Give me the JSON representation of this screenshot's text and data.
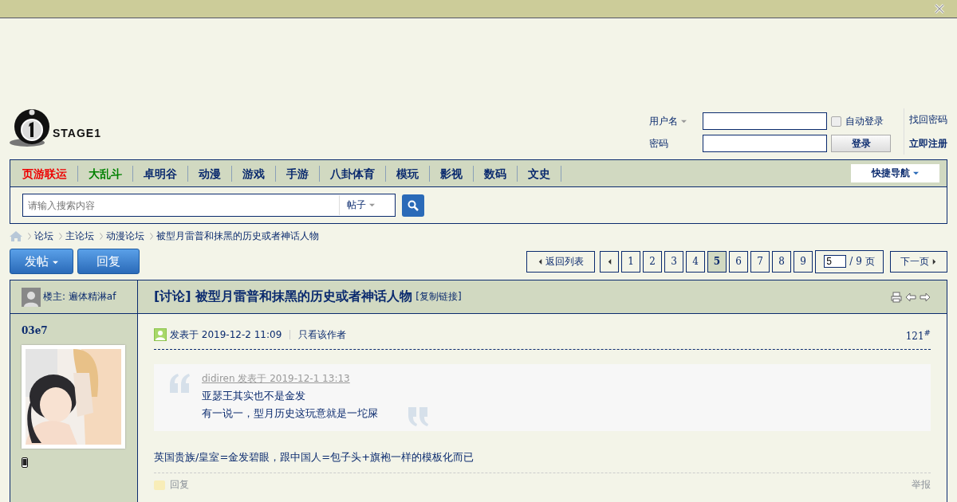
{
  "logo": {
    "text": "STAGE1"
  },
  "login": {
    "username_label": "用户名",
    "password_label": "密码",
    "auto_login": {
      "label": "自动登录",
      "checked": false
    },
    "login_button": "登录",
    "forgot": "找回密码",
    "register": "立即注册"
  },
  "nav": {
    "items": [
      {
        "label": "页游联运",
        "color": "#ee0000"
      },
      {
        "label": "大乱斗",
        "color": "#008000"
      },
      {
        "label": "卓明谷",
        "color": "#0a2a6e"
      },
      {
        "label": "动漫",
        "color": "#0a2a6e"
      },
      {
        "label": "游戏",
        "color": "#0a2a6e"
      },
      {
        "label": "手游",
        "color": "#0a2a6e"
      },
      {
        "label": "八卦体育",
        "color": "#0a2a6e"
      },
      {
        "label": "模玩",
        "color": "#0a2a6e"
      },
      {
        "label": "影视",
        "color": "#0a2a6e"
      },
      {
        "label": "数码",
        "color": "#0a2a6e"
      },
      {
        "label": "文史",
        "color": "#0a2a6e"
      }
    ],
    "quick_nav": "快捷导航"
  },
  "search": {
    "placeholder": "请输入搜索内容",
    "scope": "帖子"
  },
  "breadcrumb": [
    "论坛",
    "主论坛",
    "动漫论坛",
    "被型月雷普和抹黑的历史或者神话人物"
  ],
  "actions": {
    "post": "发帖",
    "reply": "回复"
  },
  "pagination": {
    "back": "返回列表",
    "pages": [
      {
        "label": "1",
        "selected": false
      },
      {
        "label": "2",
        "selected": false
      },
      {
        "label": "3",
        "selected": false
      },
      {
        "label": "4",
        "selected": false
      },
      {
        "label": "5",
        "selected": true
      },
      {
        "label": "6",
        "selected": false
      },
      {
        "label": "7",
        "selected": false
      },
      {
        "label": "8",
        "selected": false
      },
      {
        "label": "9",
        "selected": false
      }
    ],
    "page_input": "5",
    "total": "/ 9 页",
    "next": "下一页"
  },
  "thread": {
    "op_label": "楼主: 遍体精淋af",
    "tag": "[讨论]",
    "title": "被型月雷普和抹黑的历史或者神话人物",
    "copy_link": "[复制链接]"
  },
  "post": {
    "author": "03e7",
    "posted": "发表于 2019-12-2 11:09",
    "only_author": "只看该作者",
    "floor": "121",
    "floor_mark": "#",
    "quote": {
      "source": "didiren 发表于 2019-12-1 13:13",
      "lines": [
        "亚瑟王其实也不是金发",
        "有一说一，型月历史这玩意就是一坨屎"
      ]
    },
    "body": "英国贵族/皇室=金发碧眼，跟中国人=包子头+旗袍一样的模板化而已",
    "reply": "回复",
    "report": "举报"
  }
}
